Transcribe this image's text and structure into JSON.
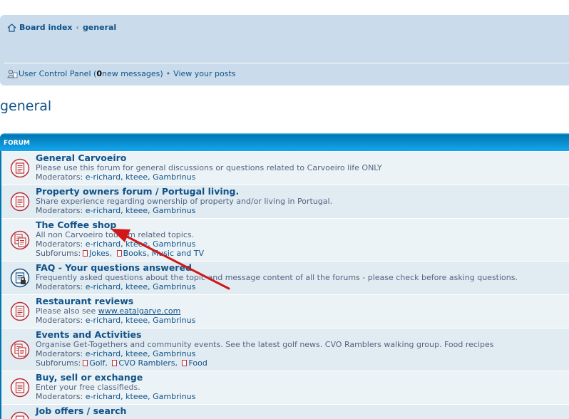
{
  "breadcrumb": {
    "home": "Board index",
    "separator": "‹",
    "current": "general"
  },
  "userbar": {
    "ucp": "User Control Panel",
    "messages_open": "(",
    "messages_count": "0",
    "messages_rest": " new messages)",
    "separator": "•",
    "view_posts": "View your posts"
  },
  "page_title": "general",
  "forum_header": "FORUM",
  "moderators_label": "Moderators:",
  "subforums_label": "Subforums:",
  "forums": [
    {
      "title": "General Carvoeiro",
      "description": "Please use this forum for general discussions or questions related to Carvoeiro life ONLY",
      "moderators": "e-richard, kteee, Gambrinus",
      "icon": "forum-read-icon"
    },
    {
      "title": "Property owners forum / Portugal living.",
      "description": "Share experience regarding ownership of property and/or living in Portugal.",
      "moderators": "e-richard, kteee, Gambrinus",
      "icon": "forum-read-icon"
    },
    {
      "title": "The Coffee shop",
      "description": "All non Carvoeiro tourism related topics.",
      "moderators": "e-richard, kteee, Gambrinus",
      "subforums": [
        "Jokes",
        "Books, Music and TV"
      ],
      "icon": "forum-subforum-icon"
    },
    {
      "title": "FAQ - Your questions answered",
      "description": "Frequently asked questions about the topic and message content of all the forums - please check before asking questions.",
      "moderators": "e-richard, kteee, Gambrinus",
      "icon": "forum-locked-icon"
    },
    {
      "title": "Restaurant reviews",
      "description_prefix": "Please also see ",
      "description_link": "www.eatalgarve.com",
      "moderators": "e-richard, kteee, Gambrinus",
      "icon": "forum-read-icon"
    },
    {
      "title": "Events and Activities",
      "description": "Organise Get-Togethers and community events. See the latest golf news. CVO Ramblers walking group. Food recipes",
      "moderators": "e-richard, kteee, Gambrinus",
      "subforums": [
        "Golf",
        "CVO Ramblers",
        "Food"
      ],
      "icon": "forum-subforum-icon"
    },
    {
      "title": "Buy, sell or exchange",
      "description": "Enter your free classifieds.",
      "moderators": "e-richard, kteee, Gambrinus",
      "icon": "forum-read-icon"
    },
    {
      "title": "Job offers / search",
      "icon": "forum-read-icon"
    }
  ],
  "colors": {
    "navbar_bg": "#cadceb",
    "link": "#105289",
    "header_bg": "#0076b1",
    "row_odd": "#ecf3f7",
    "row_even": "#e1ebf2",
    "icon_red": "#b8303a",
    "arrow": "#d01818"
  }
}
